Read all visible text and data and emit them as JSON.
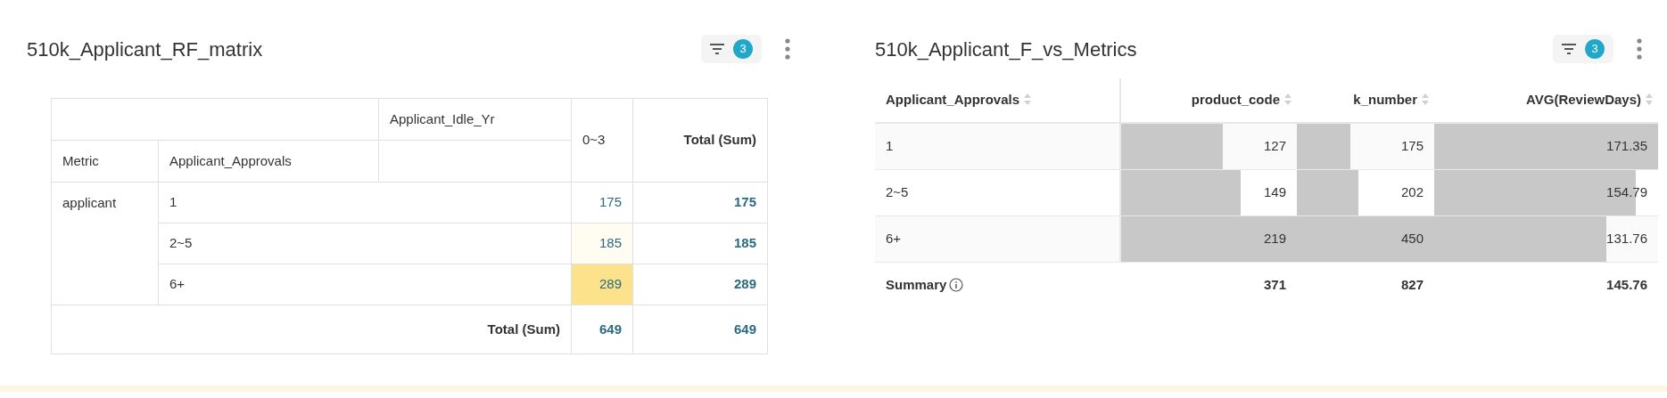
{
  "left_panel": {
    "title": "510k_Applicant_RF_matrix",
    "filter_count": "3",
    "pivot": {
      "column_field": "Applicant_Idle_Yr",
      "column_value": "0~3",
      "total_label": "Total (Sum)",
      "row_headers": [
        "Metric",
        "Applicant_Approvals"
      ],
      "metric": "applicant",
      "rows": [
        {
          "label": "1",
          "value": "175",
          "color": "#ffffff",
          "total": "175"
        },
        {
          "label": "2~5",
          "value": "185",
          "color": "#fffcf2",
          "total": "185"
        },
        {
          "label": "6+",
          "value": "289",
          "color": "#fce28a",
          "total": "289"
        }
      ],
      "grand_total": {
        "label": "Total (Sum)",
        "value": "649",
        "total": "649"
      }
    }
  },
  "right_panel": {
    "title": "510k_Applicant_F_vs_Metrics",
    "filter_count": "3",
    "table": {
      "columns": [
        "Applicant_Approvals",
        "product_code",
        "k_number",
        "AVG(ReviewDays)"
      ],
      "rows": [
        {
          "cells": [
            {
              "text": "1"
            },
            {
              "text": "127",
              "level": 0.58
            },
            {
              "text": "175",
              "level": 0.39
            },
            {
              "text": "171.35",
              "level": 1.0
            }
          ]
        },
        {
          "cells": [
            {
              "text": "2~5"
            },
            {
              "text": "149",
              "level": 0.68
            },
            {
              "text": "202",
              "level": 0.45
            },
            {
              "text": "154.79",
              "level": 0.9
            }
          ]
        },
        {
          "cells": [
            {
              "text": "6+"
            },
            {
              "text": "219",
              "level": 1.0
            },
            {
              "text": "450",
              "level": 1.0
            },
            {
              "text": "131.76",
              "level": 0.77
            }
          ]
        }
      ],
      "summary": {
        "cells": [
          "Summary",
          "371",
          "827",
          "145.76"
        ]
      }
    }
  }
}
